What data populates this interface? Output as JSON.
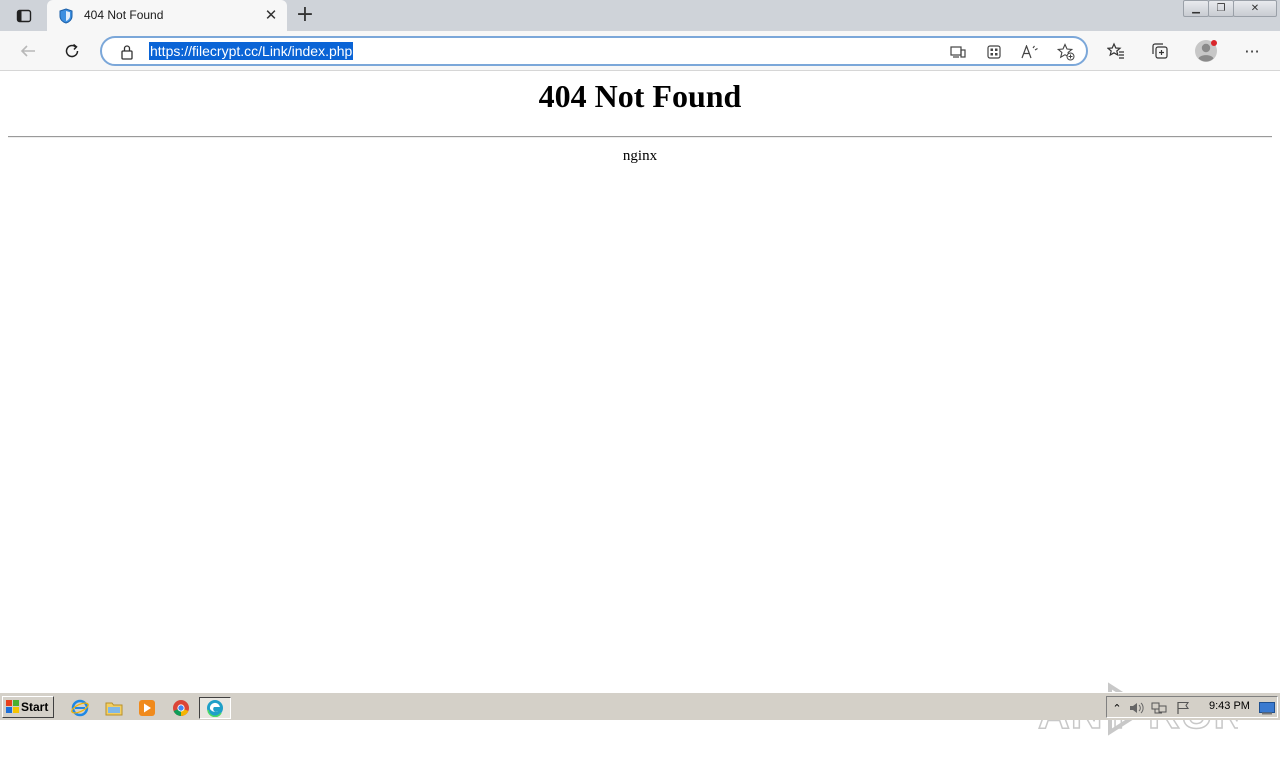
{
  "browser": {
    "tab": {
      "title": "404 Not Found",
      "close_glyph": "✕"
    },
    "new_tab_glyph": "+",
    "address_bar": {
      "url": "https://filecrypt.cc/Link/index.php"
    },
    "window_controls": {
      "minimize": "▁",
      "maximize": "❐",
      "close": "✕"
    },
    "more_glyph": "···"
  },
  "page": {
    "heading": "404 Not Found",
    "server": "nginx"
  },
  "watermark": "ANY RUN",
  "taskbar": {
    "start_label": "Start",
    "clock": "9:43 PM"
  },
  "icons": {
    "tab_actions": "tab-actions-icon",
    "favicon": "shield-icon",
    "back": "back-arrow-icon",
    "refresh": "refresh-icon",
    "lock": "lock-icon",
    "app_available": "app-available-icon",
    "apps": "apps-grid-icon",
    "read_aloud": "read-aloud-icon",
    "add_favorite": "add-favorite-icon",
    "favorites": "favorites-icon",
    "collections": "collections-icon",
    "profile": "profile-avatar-icon",
    "more": "more-icon"
  },
  "colors": {
    "tabstrip": "#cfd3d9",
    "toolbar": "#f7f7f7",
    "url_selection": "#0a64d6",
    "address_border": "#7ba7d9",
    "taskbar": "#d4d0c8"
  }
}
